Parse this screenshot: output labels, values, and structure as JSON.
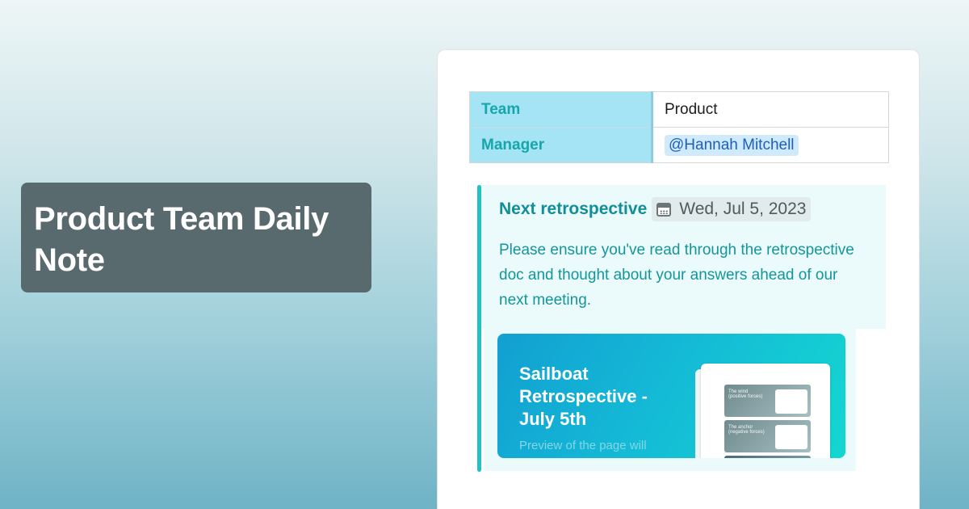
{
  "hero": {
    "title": "Product Team Daily Note"
  },
  "properties": [
    {
      "key": "Team",
      "value": "Product",
      "type": "text"
    },
    {
      "key": "Manager",
      "value": "@Hannah Mitchell",
      "type": "mention"
    }
  ],
  "callout": {
    "title": "Next retrospective",
    "date_icon": "calendar-icon",
    "date": "Wed, Jul 5, 2023",
    "body": "Please ensure you've read through the retrospective doc and thought about your answers ahead of our next meeting."
  },
  "embed": {
    "title": "Sailboat Retrospective - July 5th",
    "subtitle": "Preview of the page will",
    "thumbnail_tiles": [
      "The wind (positive forces)",
      "The anchor (negative forces)"
    ]
  },
  "colors": {
    "property_key_bg": "#a4e4f4",
    "accent_teal": "#118f98",
    "callout_bg": "#ebfafb",
    "callout_bar": "#20c2c4",
    "mention_bg": "#cfeafc",
    "title_card_bg": "#586a6e"
  }
}
